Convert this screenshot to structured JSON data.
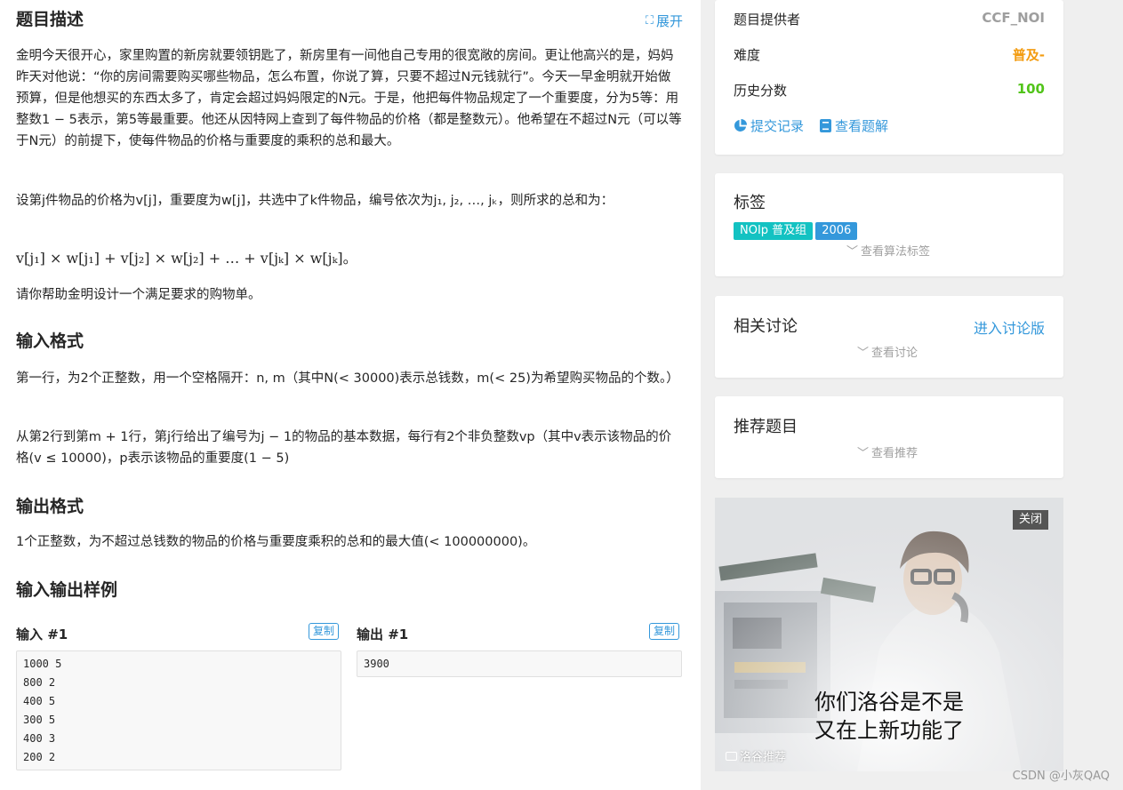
{
  "problem": {
    "desc_title": "题目描述",
    "expand_label": "展开",
    "p1": "金明今天很开心，家里购置的新房就要领钥匙了，新房里有一间他自己专用的很宽敞的房间。更让他高兴的是，妈妈昨天对他说：“你的房间需要购买哪些物品，怎么布置，你说了算，只要不超过N元钱就行”。今天一早金明就开始做预算，但是他想买的东西太多了，肯定会超过妈妈限定的N元。于是，他把每件物品规定了一个重要度，分为5等：用整数1 − 5表示，第5等最重要。他还从因特网上查到了每件物品的价格（都是整数元）。他希望在不超过N元（可以等于N元）的前提下，使每件物品的价格与重要度的乘积的总和最大。",
    "p2": "设第j件物品的价格为v[j]，重要度为w[j]，共选中了k件物品，编号依次为j₁, j₂, …, jₖ，则所求的总和为：",
    "formula": "v[j₁] × w[j₁] + v[j₂] × w[j₂] + … + v[jₖ] × w[jₖ]。",
    "p3": "请你帮助金明设计一个满足要求的购物单。",
    "input_title": "输入格式",
    "input_p1": "第一行，为2个正整数，用一个空格隔开：n, m（其中N(< 30000)表示总钱数，m(< 25)为希望购买物品的个数。）",
    "input_p2": "从第2行到第m + 1行，第j行给出了编号为j − 1的物品的基本数据，每行有2个非负整数vp（其中v表示该物品的价格(v ≤ 10000)，p表示该物品的重要度(1 − 5)",
    "output_title": "输出格式",
    "output_p1": "1个正整数，为不超过总钱数的物品的价格与重要度乘积的总和的最大值(< 100000000)。",
    "sample_title": "输入输出样例",
    "sample_in_label": "输入 #1",
    "sample_out_label": "输出 #1",
    "copy_label": "复制",
    "sample_in": "1000 5\n800 2\n400 5\n300 5\n400 3\n200 2",
    "sample_out": "3900"
  },
  "sidebar": {
    "provider_label": "题目提供者",
    "provider_value": "CCF_NOI",
    "difficulty_label": "难度",
    "difficulty_value": "普及-",
    "score_label": "历史分数",
    "score_value": "100",
    "submit_link": "提交记录",
    "solution_link": "查看题解",
    "tags_title": "标签",
    "tags": [
      "NOIp 普及组",
      "2006"
    ],
    "tags_more": "查看算法标签",
    "discuss_title": "相关讨论",
    "discuss_link": "进入讨论版",
    "discuss_more": "查看讨论",
    "recommend_title": "推荐题目",
    "recommend_more": "查看推荐"
  },
  "ad": {
    "close_label": "关闭",
    "caption_line1": "你们洛谷是不是",
    "caption_line2": "又在上新功能了",
    "brand": "洛谷推荐"
  },
  "watermark": "CSDN @小灰QAQ",
  "colors": {
    "accent": "#3498db",
    "difficulty": "#f39c11",
    "score": "#52c41a",
    "tag_noip": "#13c2c2",
    "tag_year": "#3498db"
  }
}
